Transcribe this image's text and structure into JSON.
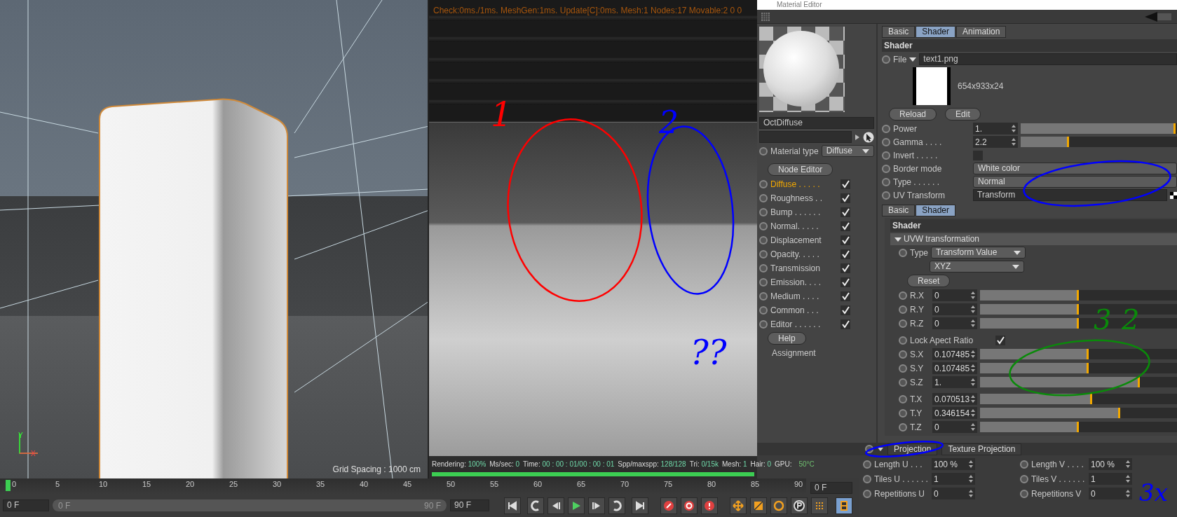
{
  "viewport": {
    "grid_spacing": "Grid Spacing : 1000 cm",
    "axis_y": "Y",
    "axis_x": "X"
  },
  "render_view": {
    "stats": "Check:0ms./1ms. MeshGen:1ms. Update[C]:0ms. Mesh:1 Nodes:17 Movable:2   0 0",
    "status": [
      {
        "label": "Rendering:",
        "value": "100%"
      },
      {
        "label": "Ms/sec:",
        "value": "0"
      },
      {
        "label": "Time:",
        "value": "00 : 00 : 01/00 : 00 : 01"
      },
      {
        "label": "Spp/maxspp:",
        "value": "128/128"
      },
      {
        "label": "Tri:",
        "value": "0/15k"
      },
      {
        "label": "Mesh:",
        "value": "1"
      },
      {
        "label": "Hair:",
        "value": "0"
      }
    ],
    "gpu_label": "GPU:",
    "gpu_temp": "50°C",
    "progress": {
      "level": 1
    }
  },
  "material_editor": {
    "title": "Material Editor",
    "material_name": "OctDiffuse",
    "material_type": {
      "label": "Material type",
      "value": "Diffuse"
    },
    "node_editor": "Node Editor",
    "channels": [
      {
        "label": "Diffuse . . . . .",
        "selected": true,
        "checked": true
      },
      {
        "label": "Roughness . .",
        "selected": false,
        "checked": true
      },
      {
        "label": "Bump . . . . . .",
        "selected": false,
        "checked": true
      },
      {
        "label": "Normal. . . . .",
        "selected": false,
        "checked": true
      },
      {
        "label": "Displacement",
        "selected": false,
        "checked": true
      },
      {
        "label": "Opacity. . . . .",
        "selected": false,
        "checked": true
      },
      {
        "label": "Transmission",
        "selected": false,
        "checked": true
      },
      {
        "label": "Emission. . . .",
        "selected": false,
        "checked": true
      },
      {
        "label": "Medium . . . .",
        "selected": false,
        "checked": true
      },
      {
        "label": "Common . . .",
        "selected": false,
        "checked": true
      },
      {
        "label": "Editor . . . . . .",
        "selected": false,
        "checked": true
      }
    ],
    "help": "Help",
    "assignment": "Assignment",
    "tabs": [
      {
        "label": "Basic",
        "selected": false
      },
      {
        "label": "Shader",
        "selected": true
      },
      {
        "label": "Animation",
        "selected": false
      }
    ],
    "section": "Shader",
    "file": {
      "label": "File",
      "value": "text1.png",
      "info": "654x933x24"
    },
    "file_buttons": [
      "Reload",
      "Edit"
    ],
    "params": [
      {
        "kind": "slider",
        "label": "Power",
        "value": "1.",
        "level": 0.99
      },
      {
        "kind": "slider",
        "label": "Gamma . . . .",
        "value": "2.2",
        "level": 0.31
      },
      {
        "kind": "checkbox",
        "label": "Invert . . . . .",
        "checked": false
      },
      {
        "kind": "dropdown",
        "label": "Border mode",
        "value": "White color"
      },
      {
        "kind": "dropdown",
        "label": "Type . . . . . .",
        "value": "Normal"
      },
      {
        "kind": "link",
        "label": "UV Transform",
        "value": "Transform"
      }
    ],
    "sub_tabs": [
      {
        "label": "Basic",
        "selected": false
      },
      {
        "label": "Shader",
        "selected": true
      }
    ],
    "sub_section": "Shader",
    "group": {
      "label": "UVW transformation",
      "expanded": true
    },
    "type": {
      "label": "Type",
      "value": "Transform Value",
      "order": "XYZ"
    },
    "reset": "Reset",
    "transform": [
      {
        "kind": "slider",
        "label": "R.X",
        "value": "0",
        "level": 0.5
      },
      {
        "kind": "slider",
        "label": "R.Y",
        "value": "0",
        "level": 0.5
      },
      {
        "kind": "slider",
        "label": "R.Z",
        "value": "0",
        "level": 0.5
      },
      {
        "kind": "checkbox",
        "label": "Lock Apect Ratio",
        "checked": true
      },
      {
        "kind": "slider",
        "label": "S.X",
        "value": "0.107485",
        "level": 0.55
      },
      {
        "kind": "slider",
        "label": "S.Y",
        "value": "0.107485",
        "level": 0.55
      },
      {
        "kind": "slider",
        "label": "S.Z",
        "value": "1.",
        "level": 0.81
      },
      {
        "kind": "slider",
        "label": "T.X",
        "value": "0.070513",
        "level": 0.57
      },
      {
        "kind": "slider",
        "label": "T.Y",
        "value": "0.346154",
        "level": 0.71
      },
      {
        "kind": "slider",
        "label": "T.Z",
        "value": "0",
        "level": 0.5
      }
    ],
    "projection_tabs": [
      "Projection",
      "Texture Projection"
    ],
    "projection_params": [
      {
        "label": "Length U . . .",
        "value": "100 %"
      },
      {
        "label": "Length V . . . .",
        "value": "100 %"
      },
      {
        "label": "Tiles U . . . . . .",
        "value": "1"
      },
      {
        "label": "Tiles V . . . . . .",
        "value": "1"
      },
      {
        "label": "Repetitions U",
        "value": "0"
      },
      {
        "label": "Repetitions V",
        "value": "0"
      }
    ]
  },
  "timeline": {
    "ticks": [
      "0",
      "5",
      "10",
      "15",
      "20",
      "25",
      "30",
      "35",
      "40",
      "45",
      "50",
      "55",
      "60",
      "65",
      "70",
      "75",
      "80",
      "85",
      "90"
    ],
    "current_frame": "0 F",
    "start": "0 F",
    "range": {
      "level": 1
    },
    "range_start": "0 F",
    "range_end": "90 F",
    "end": "90 F"
  },
  "annotations": [
    {
      "text": "1",
      "color": "#ff0000"
    },
    {
      "text": "2",
      "color": "#0000ff"
    },
    {
      "text": "??",
      "color": "#0000ff"
    },
    {
      "color": "#0000ff"
    },
    {
      "text": "3",
      "color": "#0a8a0a"
    },
    {
      "text": "2",
      "color": "#0a8a0a"
    },
    {
      "text": "3x",
      "color": "#0000ff"
    }
  ]
}
